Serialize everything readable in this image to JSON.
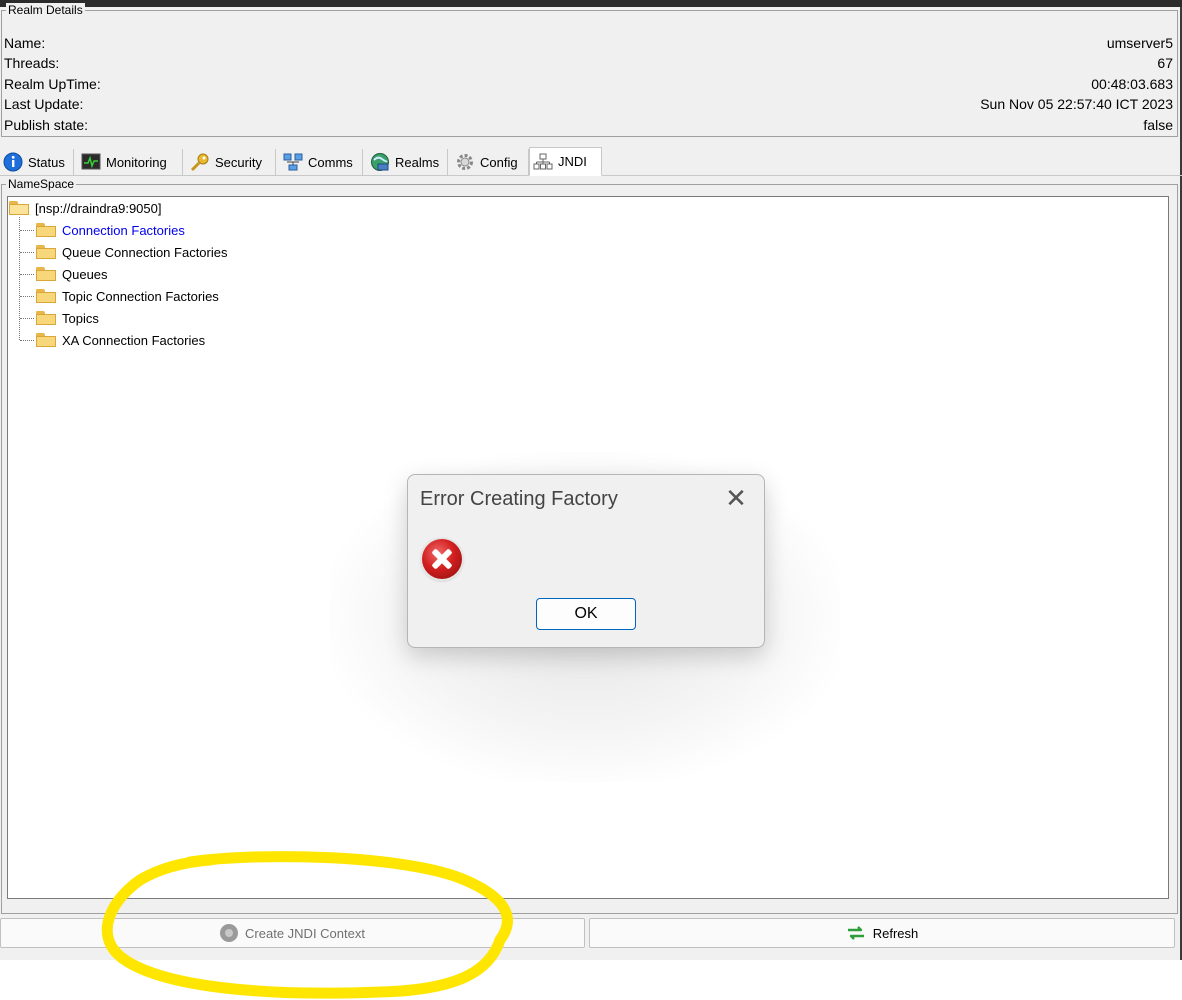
{
  "realm_details": {
    "title": "Realm Details",
    "rows": [
      {
        "label": "Name:",
        "value": "umserver5"
      },
      {
        "label": "Threads:",
        "value": "67"
      },
      {
        "label": "Realm UpTime:",
        "value": "00:48:03.683"
      },
      {
        "label": "Last Update:",
        "value": "Sun Nov 05 22:57:40 ICT 2023"
      },
      {
        "label": "Publish state:",
        "value": "false"
      }
    ]
  },
  "tabs": [
    {
      "label": "Status",
      "icon": "info-icon"
    },
    {
      "label": "Monitoring",
      "icon": "monitor-icon"
    },
    {
      "label": "Security",
      "icon": "key-icon"
    },
    {
      "label": "Comms",
      "icon": "network-icon"
    },
    {
      "label": "Realms",
      "icon": "globe-icon"
    },
    {
      "label": "Config",
      "icon": "gear-icon"
    },
    {
      "label": "JNDI",
      "icon": "jndi-tree-icon",
      "active": true
    }
  ],
  "namespace": {
    "title": "NameSpace",
    "root": "[nsp://draindra9:9050]",
    "children": [
      {
        "label": "Connection Factories",
        "selected": true
      },
      {
        "label": "Queue Connection Factories"
      },
      {
        "label": "Queues"
      },
      {
        "label": "Topic Connection Factories"
      },
      {
        "label": "Topics"
      },
      {
        "label": "XA Connection Factories"
      }
    ]
  },
  "buttons": {
    "create_context": "Create JNDI Context",
    "refresh": "Refresh"
  },
  "dialog": {
    "title": "Error Creating Factory",
    "close": "✕",
    "ok": "OK",
    "icon": "error-icon"
  },
  "colors": {
    "selected_text": "#0000ee",
    "annotation": "#ffe600"
  }
}
